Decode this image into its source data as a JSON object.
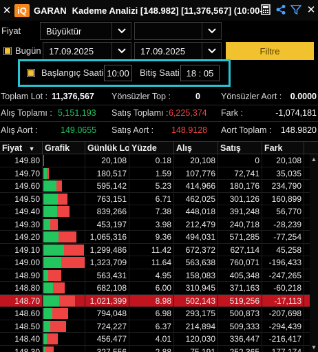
{
  "window": {
    "symbol": "GARAN",
    "title": "Kademe Analizi [148.982] [11,376,567] (10:00-",
    "logo_text": "iQ"
  },
  "icons": [
    "close-icon",
    "calculator-icon",
    "share-icon",
    "filter-icon",
    "close-icon"
  ],
  "filters": {
    "fiyat_label": "Fiyat",
    "fiyat_value": "Büyüktür",
    "fiyat_value2": "",
    "bugun_label": "Bugün",
    "bugun_checked": true,
    "date_from": "17.09.2025",
    "date_to": "17.09.2025",
    "filter_button": "Filtre"
  },
  "time": {
    "start_checked": true,
    "start_label": "Başlangıç Saati :",
    "start_value": "10:00",
    "end_label": "Bitiş Saati :",
    "end_value": "18 : 05"
  },
  "stats": {
    "toplam_lot_label": "Toplam Lot :",
    "toplam_lot": "11,376,567",
    "yonsuz_top_label": "Yönsüzler Top :",
    "yonsuz_top": "0",
    "yonsuz_aort_label": "Yönsüzler Aort :",
    "yonsuz_aort": "0.0000",
    "alis_toplami_label": "Alış Toplamı :",
    "alis_toplami": "5,151,193",
    "satis_toplami_label": "Satış Toplamı :",
    "satis_toplami": "6,225,374",
    "fark_label": "Fark :",
    "fark": "-1,074,181",
    "alis_aort_label": "Alış Aort :",
    "alis_aort": "149.0655",
    "satis_aort_label": "Satış Aort :",
    "satis_aort": "148.9128",
    "aort_toplam_label": "Aort Toplam :",
    "aort_toplam": "148.9820"
  },
  "colors": {
    "accent": "#f2c12e",
    "highlight_border": "#27c6d6",
    "positive": "#22c55e",
    "negative": "#ef4444",
    "selected_row": "#c1141f"
  },
  "table": {
    "columns": [
      "Fiyat",
      "Grafik",
      "Günlük Lo",
      "Yüzde",
      "Alış",
      "Satış",
      "Fark"
    ],
    "rows": [
      {
        "fiyat": "149.80",
        "gunluk": "20,108",
        "yuzde": "0.18",
        "alis": "20,108",
        "satis": "0",
        "fark": "20,108",
        "buy_ratio": 1.0,
        "volume": 20108
      },
      {
        "fiyat": "149.70",
        "gunluk": "180,517",
        "yuzde": "1.59",
        "alis": "107,776",
        "satis": "72,741",
        "fark": "35,035",
        "buy_ratio": 0.597,
        "volume": 180517
      },
      {
        "fiyat": "149.60",
        "gunluk": "595,142",
        "yuzde": "5.23",
        "alis": "414,966",
        "satis": "180,176",
        "fark": "234,790",
        "buy_ratio": 0.697,
        "volume": 595142
      },
      {
        "fiyat": "149.50",
        "gunluk": "763,151",
        "yuzde": "6.71",
        "alis": "462,025",
        "satis": "301,126",
        "fark": "160,899",
        "buy_ratio": 0.605,
        "volume": 763151
      },
      {
        "fiyat": "149.40",
        "gunluk": "839,266",
        "yuzde": "7.38",
        "alis": "448,018",
        "satis": "391,248",
        "fark": "56,770",
        "buy_ratio": 0.534,
        "volume": 839266
      },
      {
        "fiyat": "149.30",
        "gunluk": "453,197",
        "yuzde": "3.98",
        "alis": "212,479",
        "satis": "240,718",
        "fark": "-28,239",
        "buy_ratio": 0.469,
        "volume": 453197
      },
      {
        "fiyat": "149.20",
        "gunluk": "1,065,316",
        "yuzde": "9.36",
        "alis": "494,031",
        "satis": "571,285",
        "fark": "-77,254",
        "buy_ratio": 0.464,
        "volume": 1065316
      },
      {
        "fiyat": "149.10",
        "gunluk": "1,299,486",
        "yuzde": "11.42",
        "alis": "672,372",
        "satis": "627,114",
        "fark": "45,258",
        "buy_ratio": 0.517,
        "volume": 1299486
      },
      {
        "fiyat": "149.00",
        "gunluk": "1,323,709",
        "yuzde": "11.64",
        "alis": "563,638",
        "satis": "760,071",
        "fark": "-196,433",
        "buy_ratio": 0.426,
        "volume": 1323709
      },
      {
        "fiyat": "148.90",
        "gunluk": "563,431",
        "yuzde": "4.95",
        "alis": "158,083",
        "satis": "405,348",
        "fark": "-247,265",
        "buy_ratio": 0.281,
        "volume": 563431
      },
      {
        "fiyat": "148.80",
        "gunluk": "682,108",
        "yuzde": "6.00",
        "alis": "310,945",
        "satis": "371,163",
        "fark": "-60,218",
        "buy_ratio": 0.456,
        "volume": 682108
      },
      {
        "fiyat": "148.70",
        "gunluk": "1,021,399",
        "yuzde": "8.98",
        "alis": "502,143",
        "satis": "519,256",
        "fark": "-17,113",
        "buy_ratio": 0.492,
        "volume": 1021399,
        "selected": true
      },
      {
        "fiyat": "148.60",
        "gunluk": "794,048",
        "yuzde": "6.98",
        "alis": "293,175",
        "satis": "500,873",
        "fark": "-207,698",
        "buy_ratio": 0.369,
        "volume": 794048
      },
      {
        "fiyat": "148.50",
        "gunluk": "724,227",
        "yuzde": "6.37",
        "alis": "214,894",
        "satis": "509,333",
        "fark": "-294,439",
        "buy_ratio": 0.297,
        "volume": 724227
      },
      {
        "fiyat": "148.40",
        "gunluk": "456,477",
        "yuzde": "4.01",
        "alis": "120,030",
        "satis": "336,447",
        "fark": "-216,417",
        "buy_ratio": 0.263,
        "volume": 456477
      },
      {
        "fiyat": "148.30",
        "gunluk": "327,556",
        "yuzde": "2.88",
        "alis": "75,191",
        "satis": "252,365",
        "fark": "-177,174",
        "buy_ratio": 0.23,
        "volume": 327556
      }
    ]
  }
}
